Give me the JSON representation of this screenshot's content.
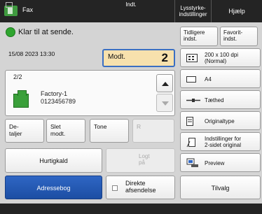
{
  "titlebar": {
    "app_title": "Fax",
    "brightness_label_line1": "Lysstyrke-",
    "brightness_label_line2": "indstillinger",
    "help_label": "Hjælp"
  },
  "status": {
    "text": "Klar til at sende.",
    "datetime": "15/08 2023 13:30"
  },
  "recipient_button": {
    "label": "Modt.",
    "count": "2"
  },
  "destination": {
    "page": "2/2",
    "name": "Factory-1",
    "number": "0123456789"
  },
  "dest_actions": {
    "details_line1": "De-",
    "details_line2": "taljer",
    "delete_line1": "Slet",
    "delete_line2": "modt.",
    "tone": "Tone",
    "r": "R"
  },
  "buttons": {
    "speed_dial": "Hurtigkald",
    "log_line1": "Logt",
    "log_line2": "på",
    "address_book": "Adressebog",
    "direct_line1": "Direkte",
    "direct_line2": "afsendelse",
    "previous_line1": "Tidligere",
    "previous_line2": "indst.",
    "favorite_line1": "Favorit-",
    "favorite_line2": "indst.",
    "options": "Tilvalg"
  },
  "settings": {
    "resolution_line1": "200 x 100 dpi",
    "resolution_line2": "(Normal)",
    "paper": "A4",
    "density": "Tæthed",
    "original_type": "Originaltype",
    "two_sided_line1": "Indstillinger for",
    "two_sided_line2": "2-sidet original",
    "preview": "Preview"
  },
  "footer": {
    "text": "Indt."
  },
  "colors": {
    "accent_blue": "#1c4ea3",
    "recipient_highlight": "#f7e1ad",
    "status_green": "#2fa52f"
  }
}
